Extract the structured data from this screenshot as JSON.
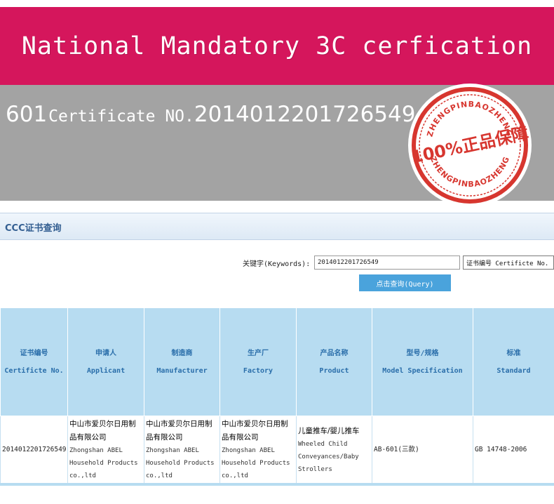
{
  "banner": {
    "title": "National Mandatory 3C cerfication"
  },
  "certificate_bar": {
    "prefix": "601",
    "label": "Certificate NO.",
    "number": "2014012201726549"
  },
  "seal": {
    "top_text": "ZHENGPINBAOZHENG",
    "bottom_text": "ZHENGPINBAOZHENG",
    "center_text": "100%正品保障",
    "color": "#d7362f"
  },
  "panel": {
    "title": "CCC证书查询"
  },
  "search": {
    "keyword_label": "关键字(Keywords):",
    "keyword_value": "2014012201726549",
    "select_value": "证书编号 Certificte No.",
    "query_button": "点击查询(Query)"
  },
  "table": {
    "headers": [
      {
        "zh": "证书编号",
        "en": "Certificte No."
      },
      {
        "zh": "申请人",
        "en": "Applicant"
      },
      {
        "zh": "制造商",
        "en": "Manufacturer"
      },
      {
        "zh": "生产厂",
        "en": "Factory"
      },
      {
        "zh": "产品名称",
        "en": "Product"
      },
      {
        "zh": "型号/规格",
        "en": "Model Specification"
      },
      {
        "zh": "标准",
        "en": "Standard"
      }
    ],
    "row": {
      "cert_no": "2014012201726549",
      "applicant_zh": "中山市爱贝尔日用制品有限公司",
      "applicant_en": "Zhongshan ABEL Household Products co.,ltd",
      "manufacturer_zh": "中山市爱贝尔日用制品有限公司",
      "manufacturer_en": "Zhongshan ABEL Household Products co.,ltd",
      "factory_zh": "中山市爱贝尔日用制品有限公司",
      "factory_en": "Zhongshan ABEL Household Products co.,ltd",
      "product_zh": "儿童推车/婴儿推车",
      "product_en": "Wheeled Child Conveyances/Baby Strollers",
      "model": "AB-601(三款)",
      "standard": "GB 14748-2006"
    }
  }
}
